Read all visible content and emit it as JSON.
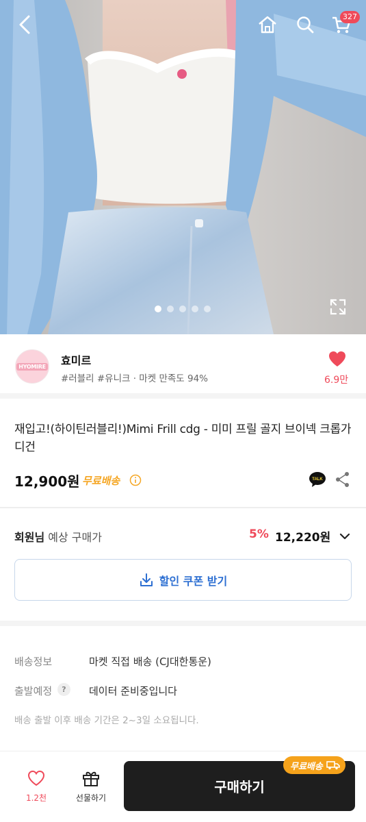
{
  "header": {
    "cart_count": "327"
  },
  "gallery": {
    "dots": 5,
    "active_dot": 0
  },
  "seller": {
    "avatar_text": "HYOMIRE",
    "name": "효미르",
    "tags": "#러블리 #유니크 · 마켓 만족도 94%",
    "likes": "6.9만"
  },
  "product": {
    "title": "재입고!(하이틴러블리!)Mimi Frill cdg - 미미 프릴 골지 브이넥 크롭가디건",
    "price": "12,900원",
    "free_shipping": "무료배송"
  },
  "member": {
    "label_bold": "회원님",
    "label_rest": " 예상 구매가",
    "discount_pct": "5%",
    "discount_price": "12,220원"
  },
  "coupon": {
    "label": "할인 쿠폰 받기"
  },
  "shipping": {
    "info_label": "배송정보",
    "info_value": "마켓 직접 배송 (CJ대한통운)",
    "depart_label": "출발예정",
    "depart_value": "데이터 준비중입니다",
    "note": "배송 출발 이후 배송 기간은 2~3일 소요됩니다."
  },
  "bottom": {
    "like_count": "1.2천",
    "gift_label": "선물하기",
    "buy_label": "구매하기",
    "ship_tag": "무료배송"
  },
  "colors": {
    "accent_red": "#ef4a5a",
    "free_ship_orange": "#f5a623",
    "coupon_blue": "#2d6fd2",
    "buy_button": "#1e1e1e"
  }
}
